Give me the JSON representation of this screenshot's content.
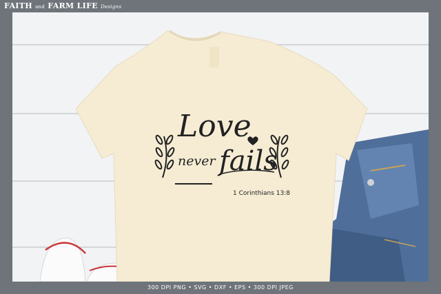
{
  "brand": {
    "faith": "FAITH",
    "and": "and",
    "farm_life": "FARM LIFE",
    "designs": "Designs"
  },
  "design": {
    "line1": "Love",
    "line2a": "never",
    "line2b": "fails",
    "verse": "1 Corinthians 13:8"
  },
  "footer": {
    "formats": "300 DPI PNG • SVG • DXF • EPS • 300 DPI JPEG"
  },
  "colors": {
    "frame": "#6e7479",
    "shirt": "#f6ecd4",
    "ink": "#222222",
    "denim": "#4f6f9a",
    "background": "#f2f3f4"
  }
}
